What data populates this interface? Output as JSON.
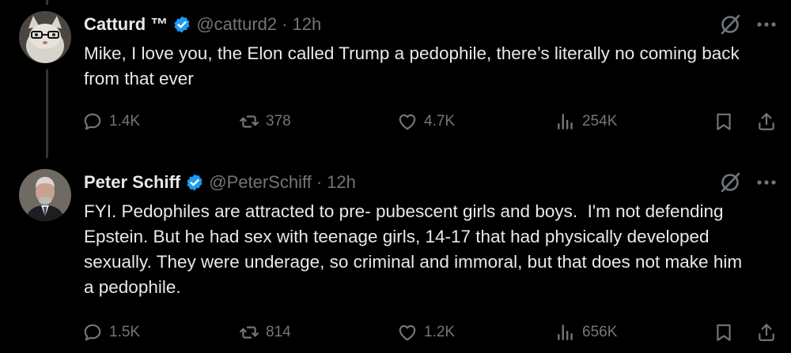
{
  "tweets": [
    {
      "name": "Catturd ™",
      "handle": "@catturd2",
      "separator": "·",
      "time": "12h",
      "text": "Mike, I love you, the Elon called Trump a pedophile, there’s literally no coming back from that ever",
      "replies": "1.4K",
      "reposts": "378",
      "likes": "4.7K",
      "views": "254K",
      "avatar": "cat-avatar"
    },
    {
      "name": "Peter Schiff",
      "handle": "@PeterSchiff",
      "separator": "·",
      "time": "12h",
      "text": "FYI. Pedophiles are attracted to pre- pubescent girls and boys.  I'm not defending Epstein. But he had sex with teenage girls, 14-17 that had physically developed sexually. They were underage, so criminal and immoral, but that does not make him a pedophile.",
      "replies": "1.5K",
      "reposts": "814",
      "likes": "1.2K",
      "views": "656K",
      "avatar": "person-avatar"
    }
  ],
  "colors": {
    "background": "#000000",
    "text": "#e7e9ea",
    "secondary": "#71767b",
    "verified": "#1d9bf0"
  },
  "icons": [
    "verified-badge-icon",
    "grok-icon",
    "more-icon",
    "reply-icon",
    "repost-icon",
    "like-icon",
    "views-icon",
    "bookmark-icon",
    "share-icon"
  ]
}
